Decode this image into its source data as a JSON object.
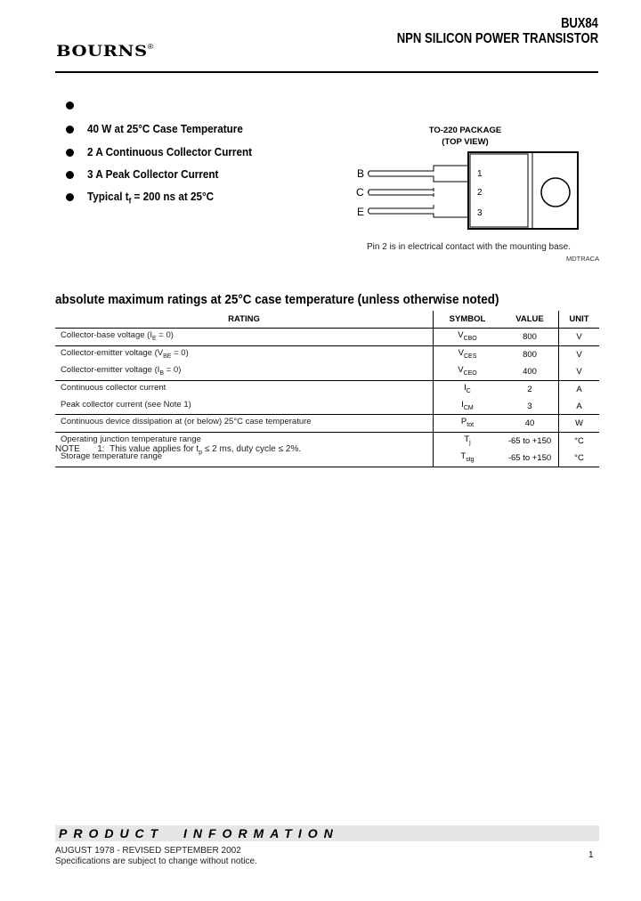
{
  "header": {
    "part_number": "BUX84",
    "title": "NPN SILICON POWER TRANSISTOR",
    "brand": "BOURNS",
    "brand_mark": "®"
  },
  "features": [
    {
      "text": ""
    },
    {
      "text": "40 W at 25°C Case Temperature"
    },
    {
      "text": "2 A Continuous Collector Current"
    },
    {
      "text": "3 A Peak Collector Current"
    },
    {
      "text_pre": "Typical t",
      "sub": "f",
      "text_post": " = 200 ns at 25°C"
    }
  ],
  "package": {
    "title_line1": "TO-220 PACKAGE",
    "title_line2": "(TOP VIEW)",
    "pins": [
      {
        "label": "B",
        "number": "1"
      },
      {
        "label": "C",
        "number": "2"
      },
      {
        "label": "E",
        "number": "3"
      }
    ],
    "caption": "Pin 2 is in electrical contact with the mounting base.",
    "figure_id": "MDTRACA"
  },
  "ratings": {
    "title": "absolute maximum ratings at 25°C case temperature (unless otherwise noted)",
    "columns": {
      "rating": "RATING",
      "symbol": "SYMBOL",
      "value": "VALUE",
      "unit": "UNIT"
    },
    "rows": [
      {
        "rating_pre": "Collector-base voltage (I",
        "rating_sub": "E",
        "rating_post": " = 0)",
        "symbol": "V",
        "symbol_sub": "CBO",
        "value": "800",
        "unit": "V"
      },
      {
        "rating_pre": "Collector-emitter voltage (V",
        "rating_sub": "BE",
        "rating_post": " = 0)",
        "symbol": "V",
        "symbol_sub": "CES",
        "value": "800",
        "unit": "V"
      },
      {
        "rating_pre": "Collector-emitter voltage (I",
        "rating_sub": "B",
        "rating_post": " = 0)",
        "symbol": "V",
        "symbol_sub": "CEO",
        "value": "400",
        "unit": "V"
      },
      {
        "rating_pre": "Continuous collector current",
        "rating_sub": "",
        "rating_post": "",
        "symbol": "I",
        "symbol_sub": "C",
        "value": "2",
        "unit": "A"
      },
      {
        "rating_pre": "Peak collector current (see Note 1)",
        "rating_sub": "",
        "rating_post": "",
        "symbol": "I",
        "symbol_sub": "CM",
        "value": "3",
        "unit": "A"
      },
      {
        "rating_pre": "Continuous device dissipation at (or below) 25°C case temperature",
        "rating_sub": "",
        "rating_post": "",
        "symbol": "P",
        "symbol_sub": "tot",
        "value": "40",
        "unit": "W"
      },
      {
        "rating_pre": "Operating junction temperature range",
        "rating_sub": "",
        "rating_post": "",
        "symbol": "T",
        "symbol_sub": "j",
        "value": "-65 to +150",
        "unit": "°C"
      },
      {
        "rating_pre": "Storage temperature range",
        "rating_sub": "",
        "rating_post": "",
        "symbol": "T",
        "symbol_sub": "stg",
        "value": "-65 to +150",
        "unit": "°C"
      }
    ]
  },
  "note": {
    "label": "NOTE",
    "number": "1:",
    "text_pre": "This value applies for t",
    "sub": "p",
    "text_post": " ≤ 2 ms, duty cycle ≤ 2%."
  },
  "footer": {
    "banner": "PRODUCT  INFORMATION",
    "date_line": "AUGUST 1978 - REVISED SEPTEMBER 2002",
    "disclaimer": "Specifications are subject to change without notice.",
    "page_number": "1"
  }
}
